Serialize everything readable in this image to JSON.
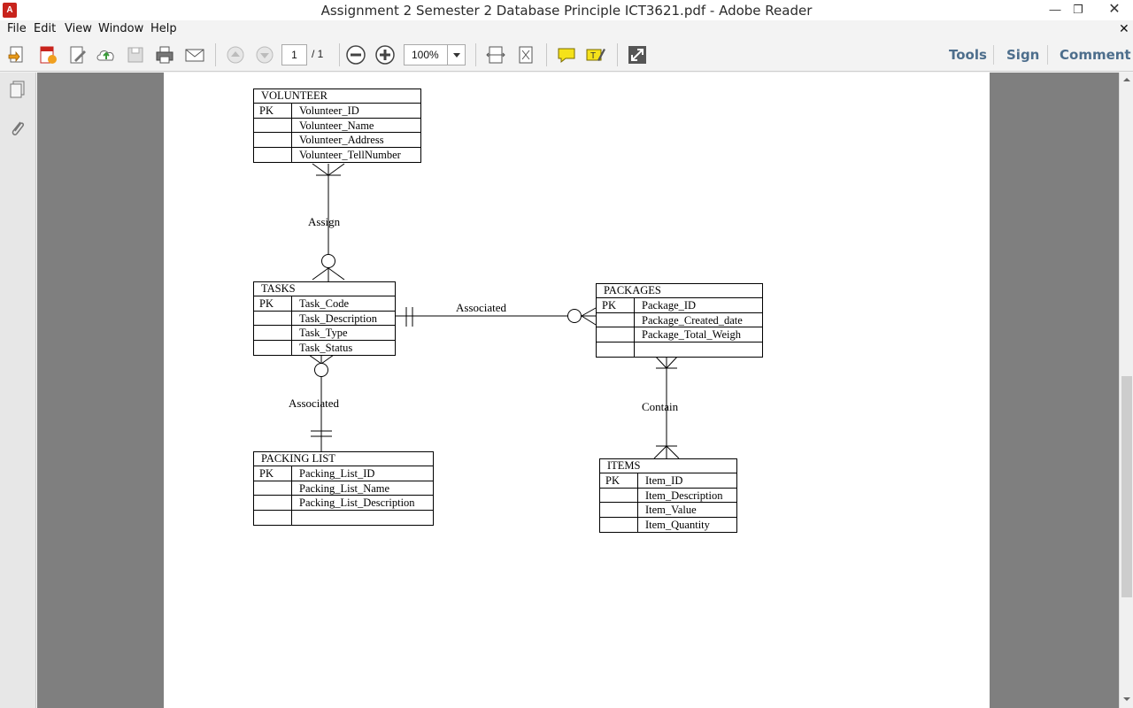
{
  "window": {
    "title": "Assignment 2 Semester 2 Database Principle ICT3621.pdf - Adobe Reader",
    "app_icon_label": "A",
    "minimize": "—",
    "maximize": "❐",
    "close": "✕"
  },
  "menu": {
    "items": [
      "File",
      "Edit",
      "View",
      "Window",
      "Help"
    ],
    "close_doc": "✕"
  },
  "toolbar": {
    "page_number": "1",
    "page_total": "/ 1",
    "zoom": "100%",
    "tools_label": "Tools",
    "sign_label": "Sign",
    "comment_label": "Comment"
  },
  "diagram": {
    "entities": [
      {
        "name": "VOLUNTEER",
        "rows": [
          {
            "key": "PK",
            "attr": "Volunteer_ID"
          },
          {
            "key": "",
            "attr": "Volunteer_Name"
          },
          {
            "key": "",
            "attr": "Volunteer_Address"
          },
          {
            "key": "",
            "attr": "Volunteer_TellNumber"
          }
        ]
      },
      {
        "name": "TASKS",
        "rows": [
          {
            "key": "PK",
            "attr": "Task_Code"
          },
          {
            "key": "",
            "attr": "Task_Description"
          },
          {
            "key": "",
            "attr": "Task_Type"
          },
          {
            "key": "",
            "attr": "Task_Status"
          }
        ]
      },
      {
        "name": "PACKAGES",
        "rows": [
          {
            "key": "PK",
            "attr": "Package_ID"
          },
          {
            "key": "",
            "attr": "Package_Created_date"
          },
          {
            "key": "",
            "attr": "Package_Total_Weigh"
          },
          {
            "key": "",
            "attr": ""
          }
        ]
      },
      {
        "name": "PACKING LIST",
        "rows": [
          {
            "key": "PK",
            "attr": "Packing_List_ID"
          },
          {
            "key": "",
            "attr": "Packing_List_Name"
          },
          {
            "key": "",
            "attr": "Packing_List_Description"
          },
          {
            "key": "",
            "attr": ""
          }
        ]
      },
      {
        "name": "ITEMS",
        "rows": [
          {
            "key": "PK",
            "attr": "Item_ID"
          },
          {
            "key": "",
            "attr": "Item_Description"
          },
          {
            "key": "",
            "attr": "Item_Value"
          },
          {
            "key": "",
            "attr": "Item_Quantity"
          }
        ]
      }
    ],
    "relationships": {
      "volunteer_tasks": "Assign",
      "tasks_packages": "Associated",
      "tasks_packinglist": "Associated",
      "packages_items": "Contain"
    }
  }
}
